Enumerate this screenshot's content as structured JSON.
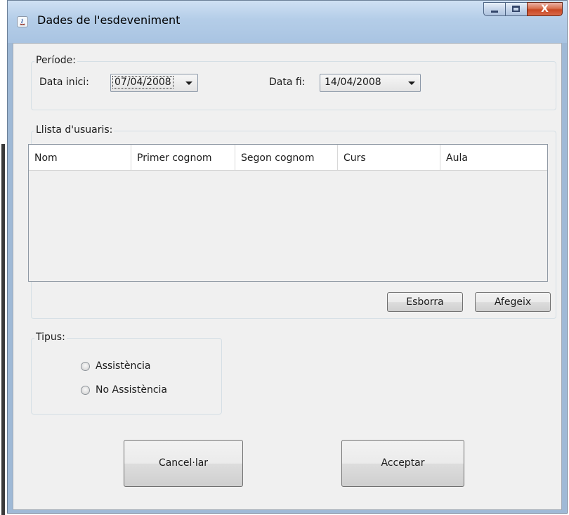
{
  "window": {
    "title": "Dades de l'esdeveniment",
    "close_glyph": "X"
  },
  "period": {
    "title": "Període:",
    "start_label": "Data inici:",
    "start_value": "07/04/2008",
    "end_label": "Data fi:",
    "end_value": "14/04/2008"
  },
  "users": {
    "title": "Llista d'usuaris:",
    "columns": [
      "Nom",
      "Primer cognom",
      "Segon cognom",
      "Curs",
      "Aula"
    ],
    "rows": [],
    "delete_label": "Esborra",
    "add_label": "Afegeix"
  },
  "type": {
    "title": "Tipus:",
    "options": [
      "Assistència",
      "No Assistència"
    ],
    "selected": null
  },
  "actions": {
    "cancel_label": "Cancel·lar",
    "accept_label": "Acceptar"
  },
  "colors": {
    "window_frame": "#a9c4e2",
    "close_button": "#c84723",
    "panel_background": "#f0f0f0"
  }
}
